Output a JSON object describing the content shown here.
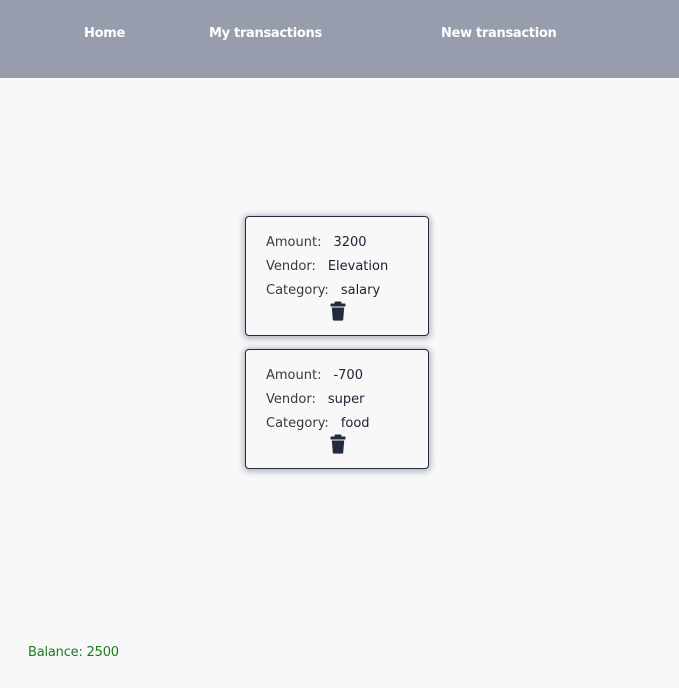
{
  "nav": {
    "home": "Home",
    "transactions": "My transactions",
    "new_transaction": "New transaction"
  },
  "transactions": [
    {
      "amount_label": "Amount:",
      "amount": "3200",
      "vendor_label": "Vendor:",
      "vendor": "Elevation",
      "category_label": "Category:",
      "category": "salary",
      "delete_icon": "trash-icon"
    },
    {
      "amount_label": "Amount:",
      "amount": "-700",
      "vendor_label": "Vendor:",
      "vendor": "super",
      "category_label": "Category:",
      "category": "food",
      "delete_icon": "trash-icon"
    }
  ],
  "balance": {
    "text": "Balance: 2500",
    "color": "#1e7a1e"
  },
  "colors": {
    "navbar_bg": "#989dae",
    "page_bg": "#f8f8f8",
    "card_border": "#232b3f",
    "icon": "#232b3f"
  }
}
